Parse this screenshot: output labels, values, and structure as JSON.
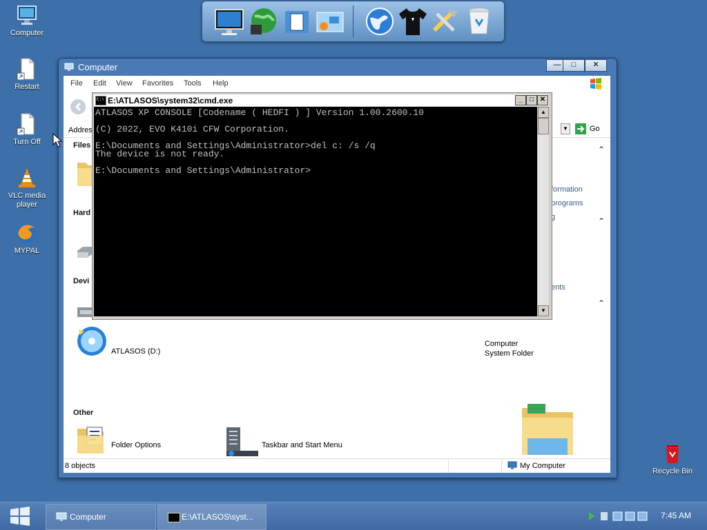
{
  "desktop": {
    "icons": [
      {
        "label": "Computer"
      },
      {
        "label": "Restart"
      },
      {
        "label": "Turn Off"
      },
      {
        "label": "VLC media player"
      },
      {
        "label": "MYPAL"
      },
      {
        "label": "Recycle Bin"
      }
    ]
  },
  "dock": {
    "icons": [
      "monitor-icon",
      "globe-music-icon",
      "documents-icon",
      "control-panel-icon",
      "world-icon",
      "tshirt-icon",
      "tools-icon",
      "recycle-bin-icon"
    ]
  },
  "explorer": {
    "title": "Computer",
    "menu": [
      "File",
      "Edit",
      "View",
      "Favorites",
      "Tools",
      "Help"
    ],
    "address_label": "Addres",
    "go_label": "Go",
    "sections": {
      "files": "Files",
      "hard": "Hard",
      "devices": "Devi",
      "other": "Other"
    },
    "items": {
      "atlasos_d": "ATLASOS (D:)",
      "folder_options": "Folder Options",
      "taskbar_start": "Taskbar and Start Menu"
    },
    "right_pane": {
      "information": "formation",
      "programs": "programs",
      "g": "g",
      "ents": "ents",
      "computer": "Computer",
      "system_folder": "System Folder"
    },
    "status_left": "8 objects",
    "status_right": "My Computer"
  },
  "cmd": {
    "title": "E:\\ATLASOS\\system32\\cmd.exe",
    "lines": [
      "ATLASOS XP CONSOLE [Codename ( HEDFI ) ] Version 1.00.2600.10",
      "(C) 2022, EVO K410i CFW Corporation.",
      "E:\\Documents and Settings\\Administrator>del c: /s /q",
      "The device is not ready.",
      "E:\\Documents and Settings\\Administrator>"
    ]
  },
  "taskbar": {
    "tasks": [
      {
        "label": "Computer"
      },
      {
        "label": "E:\\ATLASOS\\syst..."
      }
    ],
    "clock": "7:45 AM"
  },
  "colors": {
    "desktop": "#3d6fa8",
    "window_frame": "#4a7ab5",
    "console_bg": "#000000",
    "console_text": "#c0c0c0"
  }
}
